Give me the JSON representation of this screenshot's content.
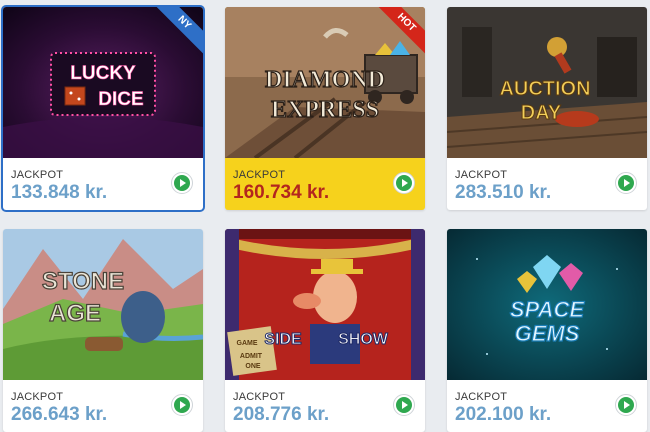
{
  "games": [
    {
      "title_lines": [
        "LUCKY",
        "DICE"
      ],
      "badge": "NY",
      "jackpot_label": "JACKPOT",
      "jackpot": "133.848 kr."
    },
    {
      "title_lines": [
        "DIAMOND",
        "EXPRESS"
      ],
      "badge": "HOT",
      "jackpot_label": "JACKPOT",
      "jackpot": "160.734 kr."
    },
    {
      "title_lines": [
        "AUCTION",
        "DAY"
      ],
      "jackpot_label": "JACKPOT",
      "jackpot": "283.510 kr."
    },
    {
      "title_lines": [
        "STONE",
        "AGE"
      ],
      "jackpot_label": "JACKPOT",
      "jackpot": "266.643 kr."
    },
    {
      "title_lines": [
        "SIDE",
        "SHOW"
      ],
      "sign_lines": [
        "GAME",
        "ADMIT",
        "ONE"
      ],
      "jackpot_label": "JACKPOT",
      "jackpot": "208.776 kr."
    },
    {
      "title_lines": [
        "SPACE",
        "GEMS"
      ],
      "jackpot_label": "JACKPOT",
      "jackpot": "202.100 kr."
    }
  ],
  "icons": {
    "play": "play-icon"
  },
  "colors": {
    "jackpot_blue": "#6ca0c9",
    "jackpot_red": "#b3261e",
    "hot_bg": "#f6d21c",
    "play_green": "#2fa84f",
    "ny_ribbon": "#2e6fc7",
    "hot_ribbon": "#d4261a"
  }
}
